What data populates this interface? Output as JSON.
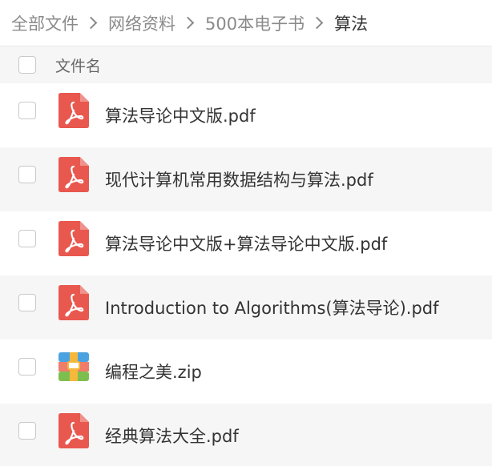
{
  "breadcrumb": {
    "items": [
      "全部文件",
      "网络资料",
      "500本电子书"
    ],
    "current": "算法"
  },
  "list": {
    "header_label": "文件名",
    "files": [
      {
        "name": "算法导论中文版.pdf",
        "icon": "pdf-icon"
      },
      {
        "name": "现代计算机常用数据结构与算法.pdf",
        "icon": "pdf-icon"
      },
      {
        "name": "算法导论中文版+算法导论中文版.pdf",
        "icon": "pdf-icon"
      },
      {
        "name": "Introduction to Algorithms(算法导论).pdf",
        "icon": "pdf-icon"
      },
      {
        "name": "编程之美.zip",
        "icon": "zip-icon"
      },
      {
        "name": "经典算法大全.pdf",
        "icon": "pdf-icon"
      }
    ]
  },
  "colors": {
    "pdf_icon": "#e8584f",
    "zip_top": "#4aa3e0",
    "zip_mid": "#f07d6a",
    "zip_bottom": "#7dbf4e",
    "zip_band": "#f5b83d",
    "alt_row_bg": "#f6f6f6"
  }
}
